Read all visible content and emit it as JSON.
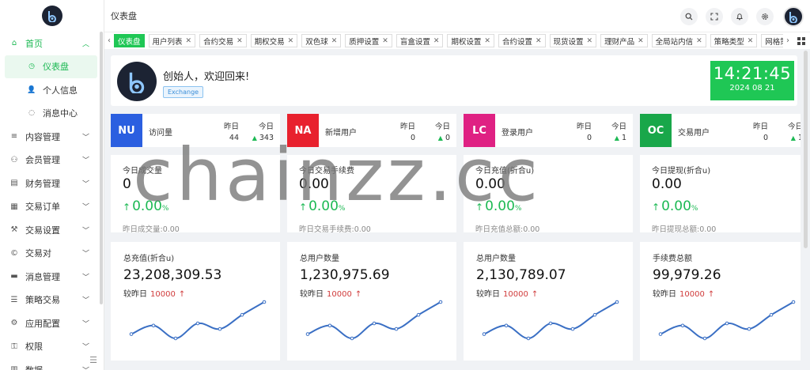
{
  "sidebar": {
    "items": [
      {
        "label": "首页",
        "icon": "home-icon",
        "glyph": "⌂"
      },
      {
        "label": "仪表盘",
        "icon": "dashboard-icon",
        "glyph": "◷"
      },
      {
        "label": "个人信息",
        "icon": "user-icon",
        "glyph": "👤"
      },
      {
        "label": "消息中心",
        "icon": "message-icon",
        "glyph": "◌"
      },
      {
        "label": "内容管理",
        "icon": "list-icon",
        "glyph": "≡"
      },
      {
        "label": "会员管理",
        "icon": "member-icon",
        "glyph": "⚇"
      },
      {
        "label": "财务管理",
        "icon": "finance-icon",
        "glyph": "▤"
      },
      {
        "label": "交易订单",
        "icon": "order-icon",
        "glyph": "▦"
      },
      {
        "label": "交易设置",
        "icon": "wrench-icon",
        "glyph": "⚒"
      },
      {
        "label": "交易对",
        "icon": "pair-icon",
        "glyph": "©"
      },
      {
        "label": "消息管理",
        "icon": "chat-icon",
        "glyph": "▬"
      },
      {
        "label": "策略交易",
        "icon": "strategy-icon",
        "glyph": "☰"
      },
      {
        "label": "应用配置",
        "icon": "config-icon",
        "glyph": "⚙"
      },
      {
        "label": "权限",
        "icon": "permission-icon",
        "glyph": "⚿"
      },
      {
        "label": "数据",
        "icon": "data-icon",
        "glyph": "▥"
      }
    ]
  },
  "header": {
    "title": "仪表盘",
    "icons": [
      "search-icon",
      "fullscreen-icon",
      "bell-icon",
      "settings-icon"
    ]
  },
  "tabs": [
    {
      "label": "仪表盘",
      "closable": false
    },
    {
      "label": "用户列表",
      "closable": true
    },
    {
      "label": "合约交易",
      "closable": true
    },
    {
      "label": "期权交易",
      "closable": true
    },
    {
      "label": "双色球",
      "closable": true
    },
    {
      "label": "质押设置",
      "closable": true
    },
    {
      "label": "盲盒设置",
      "closable": true
    },
    {
      "label": "期权设置",
      "closable": true
    },
    {
      "label": "合约设置",
      "closable": true
    },
    {
      "label": "现货设置",
      "closable": true
    },
    {
      "label": "理财产品",
      "closable": true
    },
    {
      "label": "全局站内信",
      "closable": true
    },
    {
      "label": "策略类型",
      "closable": true
    },
    {
      "label": "网格策略",
      "closable": true
    },
    {
      "label": "新手签到",
      "closable": true
    }
  ],
  "welcome": {
    "greeting": "创始人，欢迎回来!",
    "tag": "Exchange"
  },
  "clock": {
    "time": "14:21:45",
    "date": "2024 08 21"
  },
  "stats": [
    {
      "badge": "NU",
      "color": "#2b5fe0",
      "name": "访问量",
      "yesterday_label": "昨日",
      "today_label": "今日",
      "yesterday": "44",
      "today": "343"
    },
    {
      "badge": "NA",
      "color": "#e8212e",
      "name": "新增用户",
      "yesterday_label": "昨日",
      "today_label": "今日",
      "yesterday": "0",
      "today": "0"
    },
    {
      "badge": "LC",
      "color": "#df2183",
      "name": "登录用户",
      "yesterday_label": "昨日",
      "today_label": "今日",
      "yesterday": "0",
      "today": "1"
    },
    {
      "badge": "OC",
      "color": "#19a74a",
      "name": "交易用户",
      "yesterday_label": "昨日",
      "today_label": "今日",
      "yesterday": "0",
      "today": "1"
    }
  ],
  "volumes": [
    {
      "label": "今日成交量",
      "value": "0",
      "percent": "0.00",
      "pct_sign": "%",
      "yesterday": "昨日成交量:0.00"
    },
    {
      "label": "今日交易手续费",
      "value": "0.00",
      "percent": "0.00",
      "pct_sign": "%",
      "yesterday": "昨日交易手续费:0.00"
    },
    {
      "label": "今日充值(折合u)",
      "value": "0.00",
      "percent": "0.00",
      "pct_sign": "%",
      "yesterday": "昨日充值总额:0.00"
    },
    {
      "label": "今日提现(折合u)",
      "value": "0.00",
      "percent": "0.00",
      "pct_sign": "%",
      "yesterday": "昨日提现总额:0.00"
    }
  ],
  "totals": [
    {
      "label": "总充值(折合u)",
      "value": "23,208,309.53",
      "compare_label": "较昨日",
      "compare_value": "10000"
    },
    {
      "label": "总用户数量",
      "value": "1,230,975.69",
      "compare_label": "较昨日",
      "compare_value": "10000"
    },
    {
      "label": "总用户数量",
      "value": "2,130,789.07",
      "compare_label": "较昨日",
      "compare_value": "10000"
    },
    {
      "label": "手续费总额",
      "value": "99,979.26",
      "compare_label": "较昨日",
      "compare_value": "10000"
    }
  ],
  "sparkline": {
    "values": [
      1,
      3,
      0,
      3.5,
      2.2,
      5.5,
      8.5
    ],
    "color": "#3a6fc4"
  },
  "watermark": "chainzz.cc"
}
